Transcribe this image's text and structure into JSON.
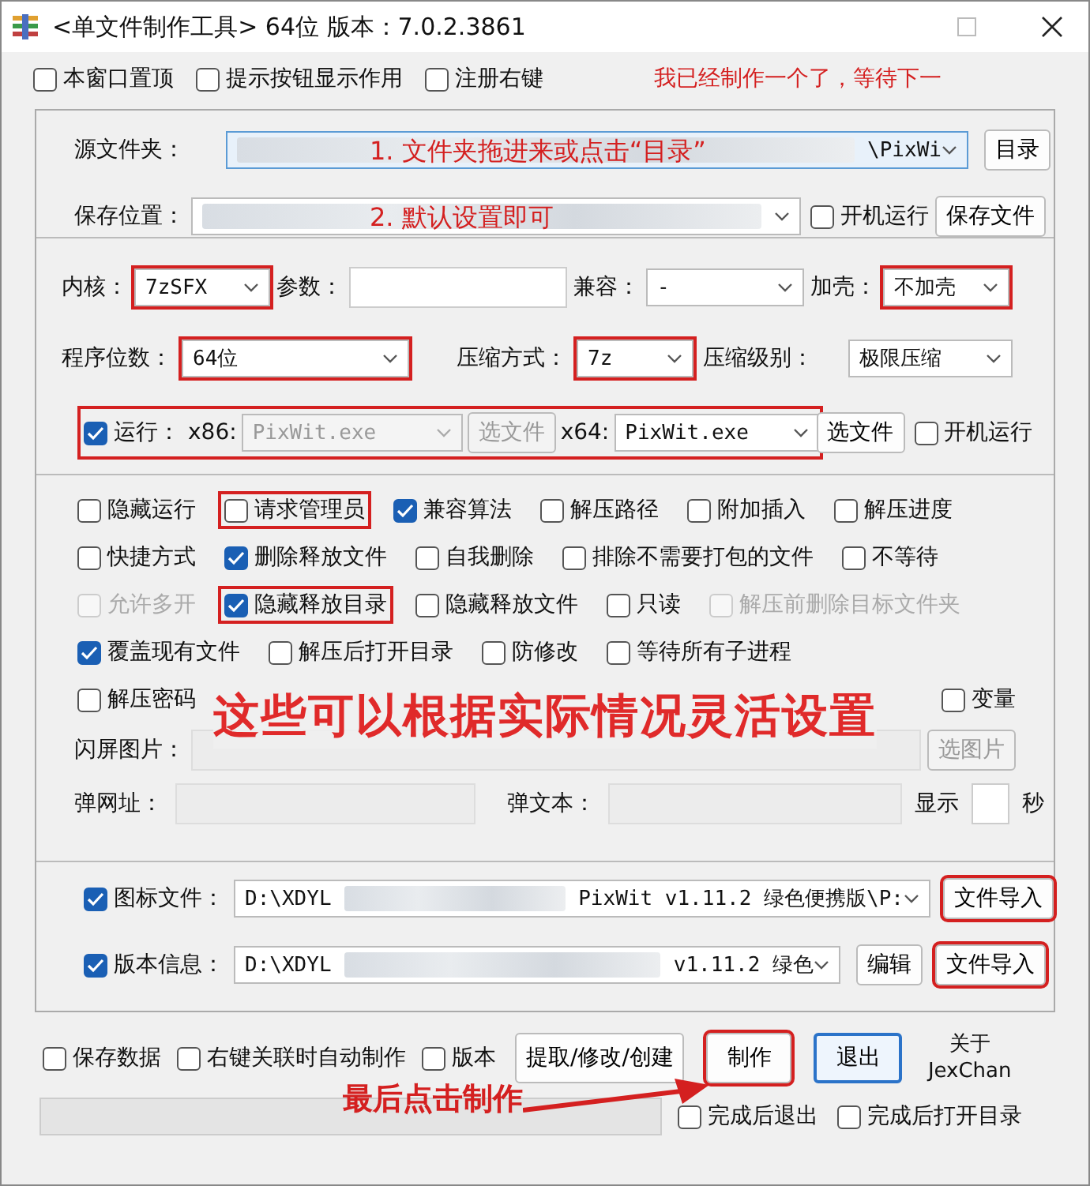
{
  "window": {
    "title": "<单文件制作工具> 64位 版本：7.0.2.3861"
  },
  "top_options": [
    {
      "label": "本窗口置顶",
      "checked": false
    },
    {
      "label": "提示按钮显示作用",
      "checked": false
    },
    {
      "label": "注册右键",
      "checked": false
    }
  ],
  "note": "我已经制作一个了，等待下一",
  "source": {
    "label": "源文件夹：",
    "value": "\\PixWi",
    "hint": "1. 文件夹拖进来或点击“目录”",
    "button": "目录"
  },
  "save": {
    "label": "保存位置：",
    "hint": "2. 默认设置即可",
    "autorun": {
      "label": "开机运行",
      "checked": false
    },
    "button": "保存文件"
  },
  "core": {
    "label": "内核：",
    "value": "7zSFX",
    "highlighted": true
  },
  "params": {
    "label": "参数："
  },
  "compat": {
    "label": "兼容：",
    "value": "-",
    "highlighted": false
  },
  "shell": {
    "label": "加壳：",
    "value": "不加壳",
    "highlighted": true
  },
  "bits": {
    "label": "程序位数：",
    "value": "64位",
    "highlighted": true
  },
  "method": {
    "label": "压缩方式：",
    "value": "7z",
    "highlighted": true
  },
  "level_select": {
    "label": "压缩级别：",
    "value": "极限压缩",
    "highlighted": false
  },
  "run": {
    "checked": true,
    "label": "运行：",
    "x86_label": "x86:",
    "x86_value": "PixWit.exe",
    "x86_button": "选文件",
    "x64_label": "x64:",
    "x64_value": "PixWit.exe",
    "x64_button": "选文件",
    "highlighted": true,
    "autorun": {
      "label": "开机运行",
      "checked": false
    }
  },
  "options": [
    [
      {
        "label": "隐藏运行",
        "checked": false,
        "disabled": false,
        "highlighted": false
      },
      {
        "label": "请求管理员",
        "checked": false,
        "disabled": false,
        "highlighted": true
      },
      {
        "label": "兼容算法",
        "checked": true,
        "disabled": false,
        "highlighted": false
      },
      {
        "label": "解压路径",
        "checked": false,
        "disabled": false,
        "highlighted": false
      },
      {
        "label": "附加插入",
        "checked": false,
        "disabled": false,
        "highlighted": false
      },
      {
        "label": "解压进度",
        "checked": false,
        "disabled": false,
        "highlighted": false
      }
    ],
    [
      {
        "label": "快捷方式",
        "checked": false,
        "disabled": false,
        "highlighted": false
      },
      {
        "label": "删除释放文件",
        "checked": true,
        "disabled": false,
        "highlighted": false
      },
      {
        "label": "自我删除",
        "checked": false,
        "disabled": false,
        "highlighted": false
      },
      {
        "label": "排除不需要打包的文件",
        "checked": false,
        "disabled": false,
        "highlighted": false
      },
      {
        "label": "不等待",
        "checked": false,
        "disabled": false,
        "highlighted": false
      }
    ],
    [
      {
        "label": "允许多开",
        "checked": false,
        "disabled": true,
        "highlighted": false
      },
      {
        "label": "隐藏释放目录",
        "checked": true,
        "disabled": false,
        "highlighted": true
      },
      {
        "label": "隐藏释放文件",
        "checked": false,
        "disabled": false,
        "highlighted": false
      },
      {
        "label": "只读",
        "checked": false,
        "disabled": false,
        "highlighted": false
      },
      {
        "label": "解压前删除目标文件夹",
        "checked": false,
        "disabled": true,
        "highlighted": false
      }
    ],
    [
      {
        "label": "覆盖现有文件",
        "checked": true,
        "disabled": false,
        "highlighted": false
      },
      {
        "label": "解压后打开目录",
        "checked": false,
        "disabled": false,
        "highlighted": false
      },
      {
        "label": "防修改",
        "checked": false,
        "disabled": false,
        "highlighted": false
      },
      {
        "label": "等待所有子进程",
        "checked": false,
        "disabled": false,
        "highlighted": false
      }
    ]
  ],
  "password": {
    "label": "解压密码",
    "checked": false
  },
  "variable": {
    "label": "变量",
    "checked": false
  },
  "big_note": "这些可以根据实际情况灵活设置",
  "splash": {
    "label": "闪屏图片：",
    "button": "选图片"
  },
  "popup": {
    "url_label": "弹网址：",
    "text_label": "弹文本：",
    "show_label": "显示",
    "sec_label": "秒"
  },
  "icon_file": {
    "checked": true,
    "label": "图标文件：",
    "value_start": "D:\\XDYL",
    "value_end": "PixWit v1.11.2 绿色便携版\\P:",
    "button": "文件导入",
    "highlighted": true
  },
  "version_info": {
    "checked": true,
    "label": "版本信息：",
    "value_start": "D:\\XDYL",
    "value_end": "v1.11.2 绿色",
    "edit_button": "编辑",
    "button": "文件导入",
    "highlighted": true
  },
  "bottom_options": [
    {
      "label": "保存数据",
      "checked": false
    },
    {
      "label": "右键关联时自动制作",
      "checked": false
    },
    {
      "label": "版本",
      "checked": false
    }
  ],
  "buttons": [
    {
      "label": "提取/修改/创建",
      "highlighted": false,
      "focused": false
    },
    {
      "label": "制作",
      "highlighted": true,
      "focused": false
    },
    {
      "label": "退出",
      "highlighted": false,
      "focused": true
    }
  ],
  "about": [
    "关于",
    "JexChan"
  ],
  "make_note": "最后点击制作",
  "progress": {
    "level": 0
  },
  "finish_options": [
    {
      "label": "完成后退出",
      "checked": false
    },
    {
      "label": "完成后打开目录",
      "checked": false
    }
  ]
}
